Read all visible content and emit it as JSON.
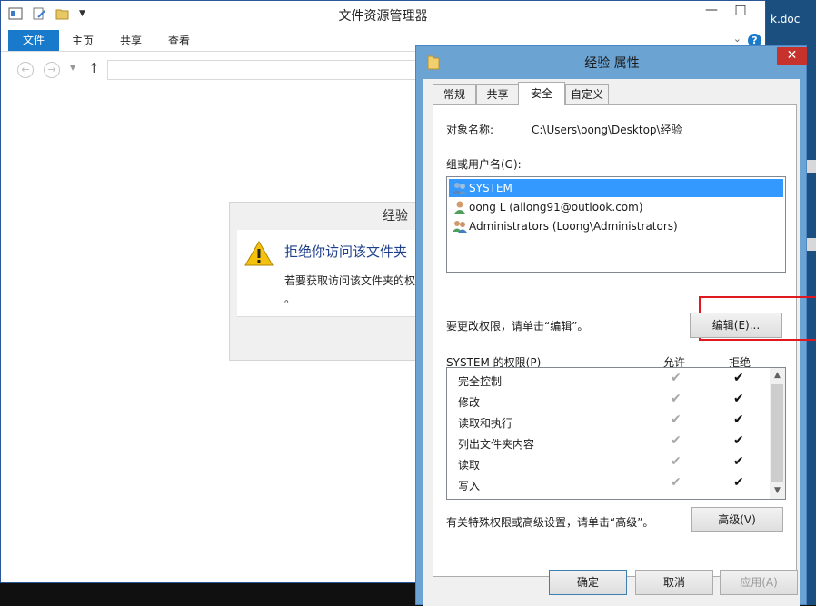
{
  "desktop": {
    "file_label": "k.doc"
  },
  "explorer": {
    "title": "文件资源管理器",
    "tabs": {
      "file": "文件",
      "home": "主页",
      "share": "共享",
      "view": "查看"
    },
    "help": "?",
    "controls": {
      "minimize": "—",
      "maximize": "□"
    }
  },
  "denied_dialog": {
    "title": "经验",
    "heading": "拒绝你访问该文件夹",
    "message_line1": "若要获取访问该文件夹的权限",
    "message_line2": "。"
  },
  "properties": {
    "title": "经验 属性",
    "close": "✕",
    "tabs": [
      "常规",
      "共享",
      "安全",
      "自定义"
    ],
    "object_label": "对象名称:",
    "object_value": "C:\\Users\\oong\\Desktop\\经验",
    "group_label": "组或用户名(G):",
    "users": [
      {
        "name": "SYSTEM",
        "icon": "users-group-icon"
      },
      {
        "name": "oong L (ailong91@outlook.com)",
        "icon": "user-icon"
      },
      {
        "name": "Administrators (Loong\\Administrators)",
        "icon": "users-group-icon"
      }
    ],
    "edit_hint": "要更改权限，请单击“编辑”。",
    "edit_button": "编辑(E)...",
    "perm_label": "SYSTEM 的权限(P)",
    "allow_header": "允许",
    "deny_header": "拒绝",
    "permissions": [
      "完全控制",
      "修改",
      "读取和执行",
      "列出文件夹内容",
      "读取",
      "写入"
    ],
    "allow_mark": "✔",
    "deny_mark": "✔",
    "advanced_hint": "有关特殊权限或高级设置，请单击“高级”。",
    "advanced_button": "高级(V)",
    "ok_button": "确定",
    "cancel_button": "取消",
    "apply_button": "应用(A)"
  }
}
